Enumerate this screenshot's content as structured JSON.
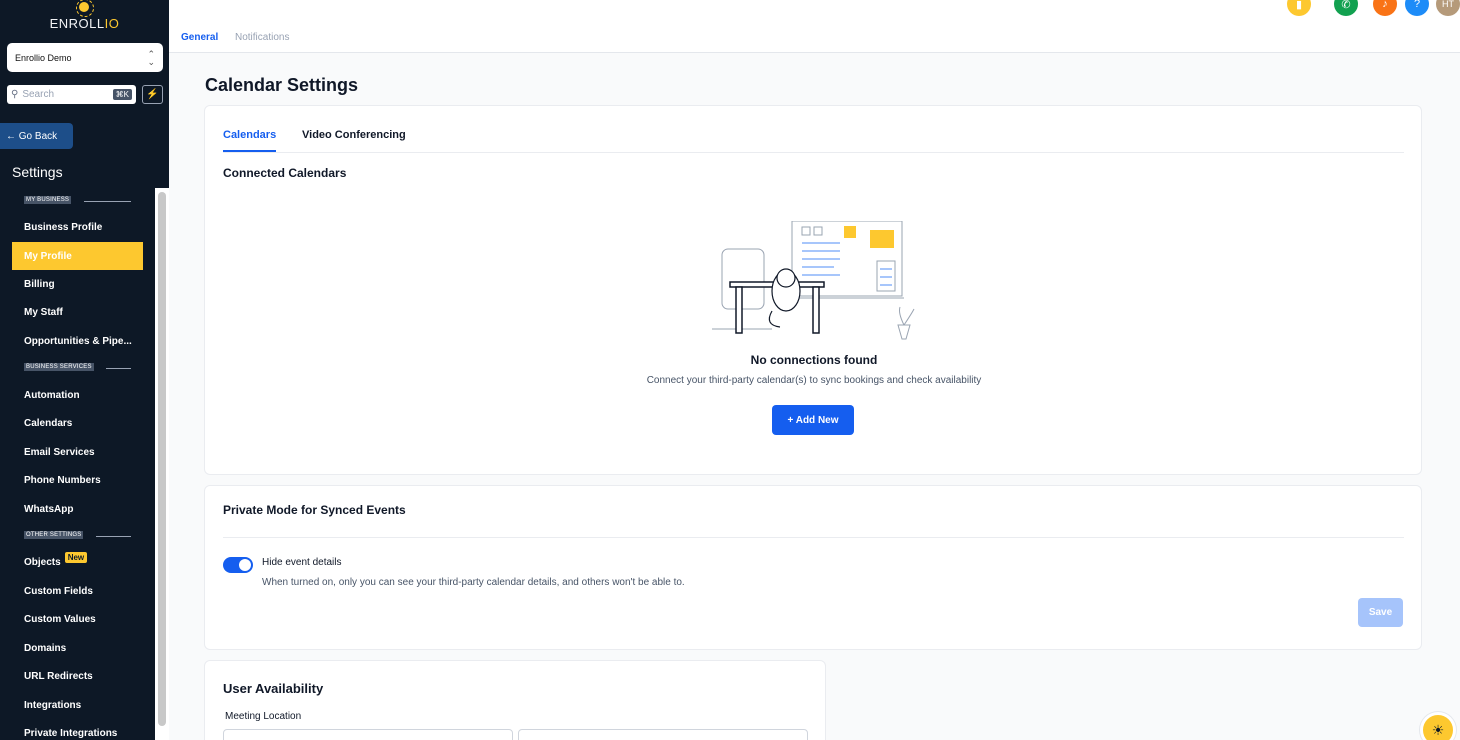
{
  "brand": {
    "name_main": "ENROLL",
    "name_accent": "IO"
  },
  "account": {
    "name": "Enrollio Demo"
  },
  "search": {
    "placeholder": "Search",
    "shortcut": "⌘K"
  },
  "go_back": "← Go Back",
  "sidebar": {
    "title": "Settings",
    "sections": [
      {
        "label": "MY BUSINESS"
      },
      {
        "label": "BUSINESS SERVICES"
      },
      {
        "label": "OTHER SETTINGS"
      }
    ],
    "items": [
      {
        "label": "Business Profile"
      },
      {
        "label": "My Profile"
      },
      {
        "label": "Billing"
      },
      {
        "label": "My Staff"
      },
      {
        "label": "Opportunities & Pipe..."
      },
      {
        "label": "Automation"
      },
      {
        "label": "Calendars"
      },
      {
        "label": "Email Services"
      },
      {
        "label": "Phone Numbers"
      },
      {
        "label": "WhatsApp"
      },
      {
        "label": "Objects",
        "badge": "New"
      },
      {
        "label": "Custom Fields"
      },
      {
        "label": "Custom Values"
      },
      {
        "label": "Domains"
      },
      {
        "label": "URL Redirects"
      },
      {
        "label": "Integrations"
      },
      {
        "label": "Private Integrations"
      }
    ],
    "active_item": "My Profile"
  },
  "top_tabs": [
    {
      "label": "General",
      "active": true
    },
    {
      "label": "Notifications",
      "active": false
    }
  ],
  "top_icons": [
    {
      "name": "notes-icon",
      "color": "#fdc82f"
    },
    {
      "name": "phone-icon",
      "color": "#12a150"
    },
    {
      "name": "bell-icon",
      "color": "#f97316"
    },
    {
      "name": "help-icon",
      "color": "#1d8cf8",
      "glyph": "?"
    },
    {
      "name": "avatar",
      "color": "#b59a7a",
      "initials": "HT"
    }
  ],
  "page": {
    "title": "Calendar Settings",
    "calendar_tabs": [
      {
        "label": "Calendars",
        "active": true
      },
      {
        "label": "Video Conferencing",
        "active": false
      }
    ],
    "connected": {
      "title": "Connected Calendars",
      "empty_title": "No connections found",
      "empty_desc": "Connect your third-party calendar(s) to sync bookings and check availability",
      "add_button": "+ Add New"
    },
    "private_mode": {
      "title": "Private Mode for Synced Events",
      "toggle_label": "Hide event details",
      "toggle_on": true,
      "toggle_desc": "When turned on, only you can see your third-party calendar details, and others won't be able to.",
      "save_label": "Save"
    },
    "availability": {
      "title": "User Availability",
      "meeting_location_label": "Meeting Location"
    }
  },
  "colors": {
    "primary": "#155eef",
    "accent": "#fdc82f",
    "sidebar_bg": "#0d1826"
  }
}
